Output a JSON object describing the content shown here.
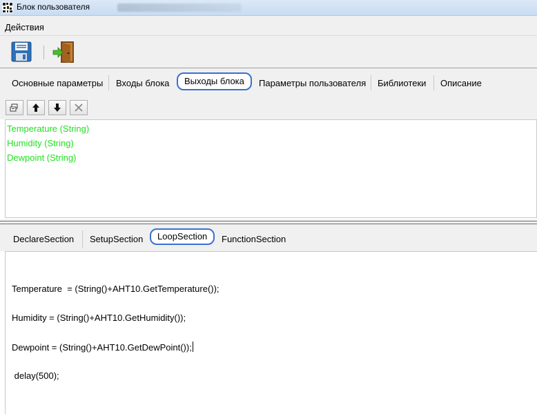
{
  "window": {
    "title": "Блок пользователя"
  },
  "menu": {
    "actions_label": "Действия"
  },
  "toolbar": {
    "save_icon": "floppy-disk",
    "exit_icon": "exit-door"
  },
  "tabs": [
    {
      "label": "Основные параметры",
      "active": false
    },
    {
      "label": "Входы блока",
      "active": false
    },
    {
      "label": "Выходы блока",
      "active": true
    },
    {
      "label": "Параметры пользователя",
      "active": false
    },
    {
      "label": "Библиотеки",
      "active": false
    },
    {
      "label": "Описание",
      "active": false
    }
  ],
  "outputs": {
    "color": "#22e022",
    "items": [
      "Temperature (String)",
      "Humidity (String)",
      "Dewpoint (String)"
    ]
  },
  "sections": [
    {
      "label": "DeclareSection",
      "active": false
    },
    {
      "label": "SetupSection",
      "active": false
    },
    {
      "label": "LoopSection",
      "active": true
    },
    {
      "label": "FunctionSection",
      "active": false
    }
  ],
  "code": [
    "Temperature  = (String()+AHT10.GetTemperature());",
    "Humidity = (String()+AHT10.GetHumidity());",
    "Dewpoint = (String()+AHT10.GetDewPoint());",
    " delay(500);"
  ],
  "colors": {
    "accent": "#3a6fd0"
  }
}
